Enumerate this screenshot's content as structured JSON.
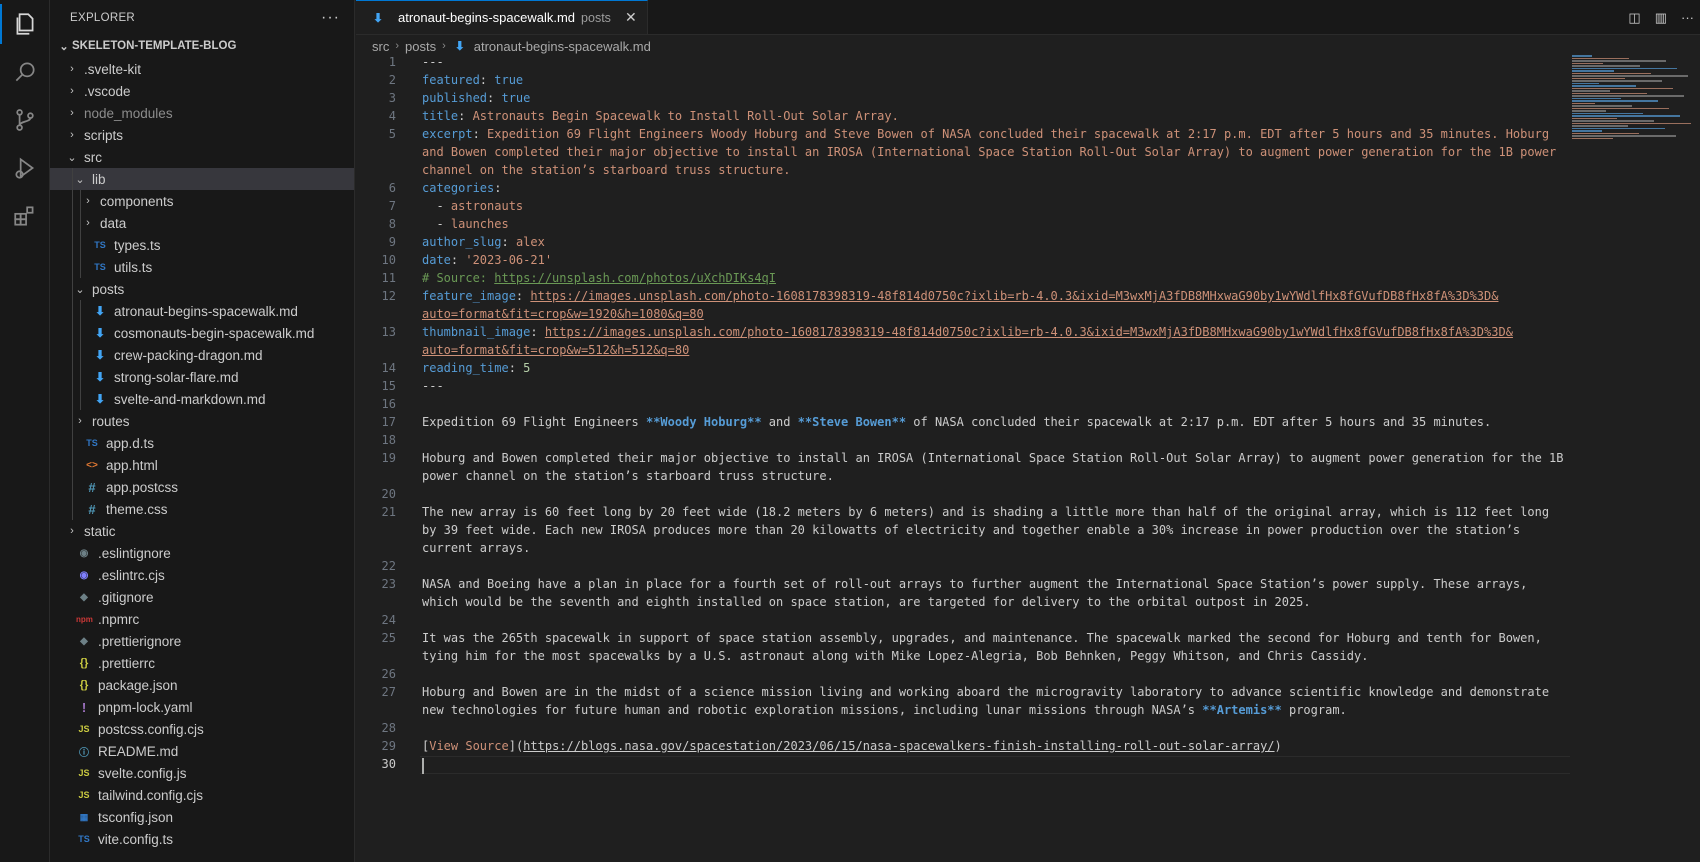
{
  "sidebar": {
    "title": "EXPLORER",
    "root": "SKELETON-TEMPLATE-BLOG",
    "items": [
      {
        "label": ".svelte-kit",
        "depth": 1,
        "type": "folder"
      },
      {
        "label": ".vscode",
        "depth": 1,
        "type": "folder"
      },
      {
        "label": "node_modules",
        "depth": 1,
        "type": "folder",
        "dim": true
      },
      {
        "label": "scripts",
        "depth": 1,
        "type": "folder"
      },
      {
        "label": "src",
        "depth": 1,
        "type": "folder-open"
      },
      {
        "label": "lib",
        "depth": 2,
        "type": "folder-open",
        "selected": true
      },
      {
        "label": "components",
        "depth": 3,
        "type": "folder"
      },
      {
        "label": "data",
        "depth": 3,
        "type": "folder"
      },
      {
        "label": "types.ts",
        "depth": 3,
        "type": "ts"
      },
      {
        "label": "utils.ts",
        "depth": 3,
        "type": "ts"
      },
      {
        "label": "posts",
        "depth": 2,
        "type": "folder-open"
      },
      {
        "label": "atronaut-begins-spacewalk.md",
        "depth": 3,
        "type": "md"
      },
      {
        "label": "cosmonauts-begin-spacewalk.md",
        "depth": 3,
        "type": "md"
      },
      {
        "label": "crew-packing-dragon.md",
        "depth": 3,
        "type": "md"
      },
      {
        "label": "strong-solar-flare.md",
        "depth": 3,
        "type": "md"
      },
      {
        "label": "svelte-and-markdown.md",
        "depth": 3,
        "type": "md"
      },
      {
        "label": "routes",
        "depth": 2,
        "type": "folder"
      },
      {
        "label": "app.d.ts",
        "depth": 2,
        "type": "ts"
      },
      {
        "label": "app.html",
        "depth": 2,
        "type": "html"
      },
      {
        "label": "app.postcss",
        "depth": 2,
        "type": "css"
      },
      {
        "label": "theme.css",
        "depth": 2,
        "type": "css"
      },
      {
        "label": "static",
        "depth": 1,
        "type": "folder"
      },
      {
        "label": ".eslintignore",
        "depth": 1,
        "type": "eslint-ignore"
      },
      {
        "label": ".eslintrc.cjs",
        "depth": 1,
        "type": "eslint"
      },
      {
        "label": ".gitignore",
        "depth": 1,
        "type": "dot"
      },
      {
        "label": ".npmrc",
        "depth": 1,
        "type": "npm"
      },
      {
        "label": ".prettierignore",
        "depth": 1,
        "type": "dot"
      },
      {
        "label": ".prettierrc",
        "depth": 1,
        "type": "json"
      },
      {
        "label": "package.json",
        "depth": 1,
        "type": "json"
      },
      {
        "label": "pnpm-lock.yaml",
        "depth": 1,
        "type": "yaml"
      },
      {
        "label": "postcss.config.cjs",
        "depth": 1,
        "type": "js"
      },
      {
        "label": "README.md",
        "depth": 1,
        "type": "info"
      },
      {
        "label": "svelte.config.js",
        "depth": 1,
        "type": "js"
      },
      {
        "label": "tailwind.config.cjs",
        "depth": 1,
        "type": "js"
      },
      {
        "label": "tsconfig.json",
        "depth": 1,
        "type": "tsconfig"
      },
      {
        "label": "vite.config.ts",
        "depth": 1,
        "type": "ts"
      }
    ]
  },
  "tab": {
    "label": "atronaut-begins-spacewalk.md",
    "description": "posts"
  },
  "breadcrumb": [
    "src",
    "posts",
    "atronaut-begins-spacewalk.md"
  ],
  "icons": {
    "activity": [
      "files-icon",
      "search-icon",
      "source-control-icon",
      "run-debug-icon",
      "extensions-icon"
    ],
    "editor_actions": [
      "open-preview-icon",
      "split-editor-icon",
      "more-actions-icon"
    ]
  },
  "colors": {
    "accent": "#0078d4",
    "key": "#569cd6",
    "string": "#ce9178",
    "comment": "#6a9955"
  },
  "lines": [
    {
      "n": 1,
      "rows": [
        [
          [
            "punc",
            "---"
          ]
        ]
      ]
    },
    {
      "n": 2,
      "rows": [
        [
          [
            "key",
            "featured"
          ],
          [
            "punc",
            ": "
          ],
          [
            "bool",
            "true"
          ]
        ]
      ]
    },
    {
      "n": 3,
      "rows": [
        [
          [
            "key",
            "published"
          ],
          [
            "punc",
            ": "
          ],
          [
            "bool",
            "true"
          ]
        ]
      ]
    },
    {
      "n": 4,
      "rows": [
        [
          [
            "key",
            "title"
          ],
          [
            "punc",
            ": "
          ],
          [
            "str",
            "Astronauts Begin Spacewalk to Install Roll-Out Solar Array."
          ]
        ]
      ]
    },
    {
      "n": 5,
      "rows": [
        [
          [
            "key",
            "excerpt"
          ],
          [
            "punc",
            ": "
          ],
          [
            "str",
            "Expedition 69 Flight Engineers Woody Hoburg and Steve Bowen of NASA concluded their spacewalk at 2:17 p.m. EDT after 5 hours and 35 minutes. Hoburg"
          ]
        ],
        [
          [
            "str",
            "and Bowen completed their major objective to install an IROSA (International Space Station Roll-Out Solar Array) to augment power generation for the 1B power"
          ]
        ],
        [
          [
            "str",
            "channel on the station’s starboard truss structure."
          ]
        ]
      ]
    },
    {
      "n": 6,
      "rows": [
        [
          [
            "key",
            "categories"
          ],
          [
            "punc",
            ":"
          ]
        ]
      ]
    },
    {
      "n": 7,
      "rows": [
        [
          [
            "punc",
            "  - "
          ],
          [
            "str",
            "astronauts"
          ]
        ]
      ]
    },
    {
      "n": 8,
      "rows": [
        [
          [
            "punc",
            "  - "
          ],
          [
            "str",
            "launches"
          ]
        ]
      ]
    },
    {
      "n": 9,
      "rows": [
        [
          [
            "key",
            "author_slug"
          ],
          [
            "punc",
            ": "
          ],
          [
            "str",
            "alex"
          ]
        ]
      ]
    },
    {
      "n": 10,
      "rows": [
        [
          [
            "key",
            "date"
          ],
          [
            "punc",
            ": "
          ],
          [
            "str",
            "'2023-06-21'"
          ]
        ]
      ]
    },
    {
      "n": 11,
      "rows": [
        [
          [
            "cmt",
            "# Source: "
          ],
          [
            "curl",
            "https://unsplash.com/photos/uXchDIKs4qI"
          ]
        ]
      ]
    },
    {
      "n": 12,
      "rows": [
        [
          [
            "key",
            "feature_image"
          ],
          [
            "punc",
            ": "
          ],
          [
            "url",
            "https://images.unsplash.com/photo-1608178398319-48f814d0750c?ixlib=rb-4.0.3&ixid=M3wxMjA3fDB8MHxwaG90by1wYWdlfHx8fGVufDB8fHx8fA%3D%3D&"
          ]
        ],
        [
          [
            "url",
            "auto=format&fit=crop&w=1920&h=1080&q=80"
          ]
        ]
      ]
    },
    {
      "n": 13,
      "rows": [
        [
          [
            "key",
            "thumbnail_image"
          ],
          [
            "punc",
            ": "
          ],
          [
            "url",
            "https://images.unsplash.com/photo-1608178398319-48f814d0750c?ixlib=rb-4.0.3&ixid=M3wxMjA3fDB8MHxwaG90by1wYWdlfHx8fGVufDB8fHx8fA%3D%3D&"
          ]
        ],
        [
          [
            "url",
            "auto=format&fit=crop&w=512&h=512&q=80"
          ]
        ]
      ]
    },
    {
      "n": 14,
      "rows": [
        [
          [
            "key",
            "reading_time"
          ],
          [
            "punc",
            ": "
          ],
          [
            "num",
            "5"
          ]
        ]
      ]
    },
    {
      "n": 15,
      "rows": [
        [
          [
            "punc",
            "---"
          ]
        ]
      ]
    },
    {
      "n": 16,
      "rows": [
        []
      ]
    },
    {
      "n": 17,
      "rows": [
        [
          [
            "punc",
            "Expedition 69 Flight Engineers "
          ],
          [
            "bold",
            "**Woody Hoburg**"
          ],
          [
            "punc",
            " and "
          ],
          [
            "bold",
            "**Steve Bowen**"
          ],
          [
            "punc",
            " of NASA concluded their spacewalk at 2:17 p.m. EDT after 5 hours and 35 minutes."
          ]
        ]
      ]
    },
    {
      "n": 18,
      "rows": [
        []
      ]
    },
    {
      "n": 19,
      "rows": [
        [
          [
            "punc",
            "Hoburg and Bowen completed their major objective to install an IROSA (International Space Station Roll-Out Solar Array) to augment power generation for the 1B"
          ]
        ],
        [
          [
            "punc",
            "power channel on the station’s starboard truss structure."
          ]
        ]
      ]
    },
    {
      "n": 20,
      "rows": [
        []
      ]
    },
    {
      "n": 21,
      "rows": [
        [
          [
            "punc",
            "The new array is 60 feet long by 20 feet wide (18.2 meters by 6 meters) and is shading a little more than half of the original array, which is 112 feet long"
          ]
        ],
        [
          [
            "punc",
            "by 39 feet wide. Each new IROSA produces more than 20 kilowatts of electricity and together enable a 30% increase in power production over the station’s"
          ]
        ],
        [
          [
            "punc",
            "current arrays."
          ]
        ]
      ]
    },
    {
      "n": 22,
      "rows": [
        []
      ]
    },
    {
      "n": 23,
      "rows": [
        [
          [
            "punc",
            "NASA and Boeing have a plan in place for a fourth set of roll-out arrays to further augment the International Space Station’s power supply. These arrays,"
          ]
        ],
        [
          [
            "punc",
            "which would be the seventh and eighth installed on space station, are targeted for delivery to the orbital outpost in 2025."
          ]
        ]
      ]
    },
    {
      "n": 24,
      "rows": [
        []
      ]
    },
    {
      "n": 25,
      "rows": [
        [
          [
            "punc",
            "It was the 265th spacewalk in support of space station assembly, upgrades, and maintenance. The spacewalk marked the second for Hoburg and tenth for Bowen,"
          ]
        ],
        [
          [
            "punc",
            "tying him for the most spacewalks by a U.S. astronaut along with Mike Lopez-Alegria, Bob Behnken, Peggy Whitson, and Chris Cassidy."
          ]
        ]
      ]
    },
    {
      "n": 26,
      "rows": [
        []
      ]
    },
    {
      "n": 27,
      "rows": [
        [
          [
            "punc",
            "Hoburg and Bowen are in the midst of a science mission living and working aboard the microgravity laboratory to advance scientific knowledge and demonstrate"
          ]
        ],
        [
          [
            "punc",
            "new technologies for future human and robotic exploration missions, including lunar missions through NASA’s "
          ],
          [
            "bold",
            "**Artemis**"
          ],
          [
            "punc",
            " program."
          ]
        ]
      ]
    },
    {
      "n": 28,
      "rows": [
        []
      ]
    },
    {
      "n": 29,
      "rows": [
        [
          [
            "punc",
            "["
          ],
          [
            "mdlink",
            "View Source"
          ],
          [
            "punc",
            "]("
          ],
          [
            "mdurl",
            "https://blogs.nasa.gov/spacestation/2023/06/15/nasa-spacewalkers-finish-installing-roll-out-solar-array/"
          ],
          [
            "punc",
            ")"
          ]
        ]
      ]
    },
    {
      "n": 30,
      "rows": [
        []
      ],
      "current": true
    }
  ]
}
